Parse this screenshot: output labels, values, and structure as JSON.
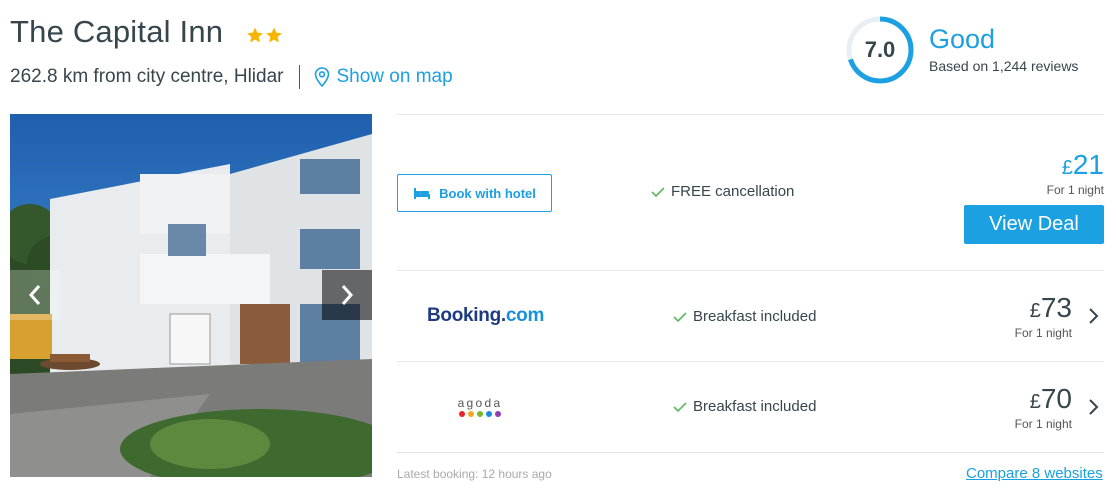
{
  "hotel": {
    "name": "The Capital Inn",
    "star_count": 2,
    "star_color": "#f7b500",
    "distance_text": "262.8 km from city centre, Hlidar",
    "map_link": "Show on map"
  },
  "rating": {
    "score": "7.0",
    "score_fraction": 0.7,
    "label": "Good",
    "reviews": "Based on 1,244 reviews",
    "color": "#1ba0e2"
  },
  "gallery": {
    "prev_icon": "chevron-left-icon",
    "next_icon": "chevron-right-icon"
  },
  "deals": [
    {
      "provider": "Book with hotel",
      "feature": "FREE cancellation",
      "currency": "£",
      "price": "21",
      "per": "For 1 night",
      "cta": "View Deal",
      "price_color": "#1ba0e2"
    },
    {
      "provider": "Booking.com",
      "logo_main": "Booking",
      "logo_dot": ".",
      "logo_tld": "com",
      "feature": "Breakfast included",
      "currency": "£",
      "price": "73",
      "per": "For 1 night"
    },
    {
      "provider": "agoda",
      "logo_text": "agoda",
      "feature": "Breakfast included",
      "currency": "£",
      "price": "70",
      "per": "For 1 night"
    }
  ],
  "footer": {
    "latest_booking": "Latest booking: 12 hours ago",
    "compare": "Compare 8 websites"
  },
  "colors": {
    "accent": "#1ba0e2",
    "text": "#37454d",
    "check": "#5cb85c"
  }
}
